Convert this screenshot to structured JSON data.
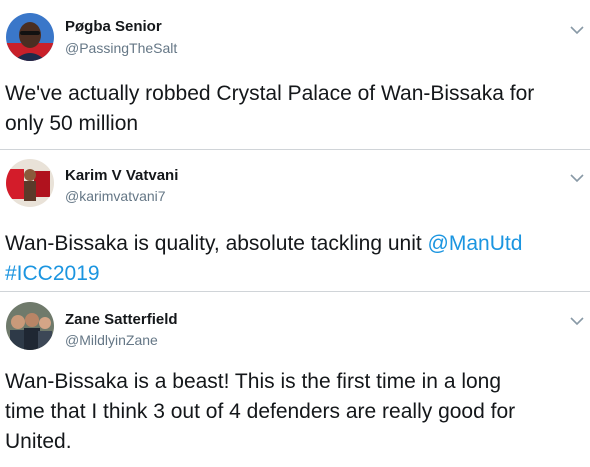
{
  "colors": {
    "text": "#14171a",
    "muted": "#657786",
    "link": "#1b95e0",
    "divider": "#d0d4d8"
  },
  "tweets": [
    {
      "display_name": "Pøgba Senior",
      "handle": "@PassingTheSalt",
      "lines": [
        "We've actually robbed Crystal Palace of Wan-Bissaka for",
        "only 50 million"
      ]
    },
    {
      "display_name": "Karim V Vatvani",
      "handle": "@karimvatvani7",
      "line1_text": "Wan-Bissaka is quality, absolute tackling unit ",
      "mention": "@ManUtd",
      "hashtag": "#ICC2019"
    },
    {
      "display_name": "Zane Satterfield",
      "handle": "@MildlyinZane",
      "lines": [
        "Wan-Bissaka is a beast! This is the first time in a long",
        "time that I think 3 out of 4 defenders are really good for",
        "United."
      ]
    }
  ],
  "icons": {
    "menu": "chevron-down-icon"
  }
}
